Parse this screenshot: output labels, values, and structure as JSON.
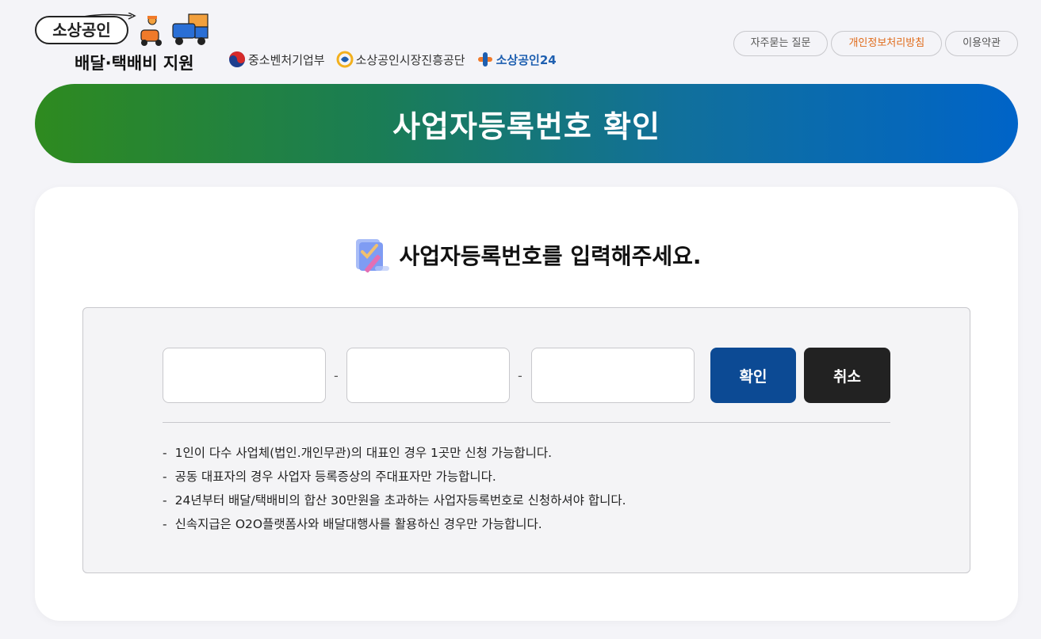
{
  "header": {
    "logo_top": "소상공인",
    "logo_bottom": "배달·택배비 지원",
    "orgs": [
      {
        "label": "중소벤처기업부",
        "icon": "taegeuk-emblem-icon"
      },
      {
        "label": "소상공인시장진흥공단",
        "icon": "semas-emblem-icon"
      },
      {
        "label": "소상공인24",
        "icon": "sosang24-logo-icon"
      }
    ],
    "links": [
      {
        "label": "자주묻는 질문"
      },
      {
        "label": "개인정보처리방침",
        "color": "#e06b1a"
      },
      {
        "label": "이용약관"
      }
    ]
  },
  "banner": {
    "title": "사업자등록번호 확인",
    "gradient": [
      "#2e8a1f",
      "#0064c8"
    ]
  },
  "form": {
    "heading": "사업자등록번호를 입력해주세요.",
    "heading_icon": "document-pen-icon",
    "fields": [
      {
        "value": "",
        "placeholder": ""
      },
      {
        "value": "",
        "placeholder": ""
      },
      {
        "value": "",
        "placeholder": ""
      }
    ],
    "separator": "-",
    "confirm_label": "확인",
    "cancel_label": "취소",
    "confirm_color": "#0c4a94",
    "cancel_color": "#222222",
    "notes": [
      "1인이 다수 사업체(법인.개인무관)의 대표인 경우 1곳만 신청 가능합니다.",
      "공동 대표자의 경우 사업자 등록증상의 주대표자만 가능합니다.",
      "24년부터 배달/택배비의 합산 30만원을 초과하는 사업자등록번호로 신청하셔야 합니다.",
      "신속지급은 O2O플랫폼사와 배달대행사를 활용하신 경우만 가능합니다."
    ]
  }
}
